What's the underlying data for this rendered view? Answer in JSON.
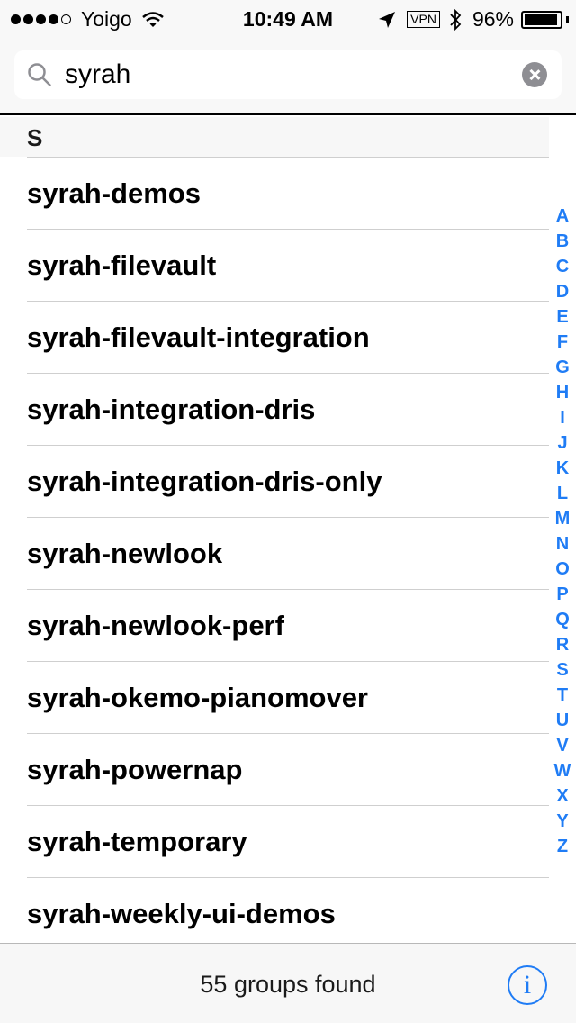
{
  "status_bar": {
    "carrier": "Yoigo",
    "time": "10:49 AM",
    "vpn": "VPN",
    "battery_percent": "96%",
    "battery_level": 0.96,
    "signal_dots_filled": 4
  },
  "search": {
    "value": "syrah",
    "placeholder": "Search"
  },
  "list": {
    "section": "S",
    "items": [
      "syrah-demos",
      "syrah-filevault",
      "syrah-filevault-integration",
      "syrah-integration-dris",
      "syrah-integration-dris-only",
      "syrah-newlook",
      "syrah-newlook-perf",
      "syrah-okemo-pianomover",
      "syrah-powernap",
      "syrah-temporary",
      "syrah-weekly-ui-demos"
    ]
  },
  "index_letters": [
    "A",
    "B",
    "C",
    "D",
    "E",
    "F",
    "G",
    "H",
    "I",
    "J",
    "K",
    "L",
    "M",
    "N",
    "O",
    "P",
    "Q",
    "R",
    "S",
    "T",
    "U",
    "V",
    "W",
    "X",
    "Y",
    "Z"
  ],
  "footer": {
    "found_text": "55 groups found",
    "info_label": "i"
  },
  "colors": {
    "accent": "#1f7cf5",
    "header_bg": "#f8f8f8",
    "separator": "#cfcfcf"
  }
}
